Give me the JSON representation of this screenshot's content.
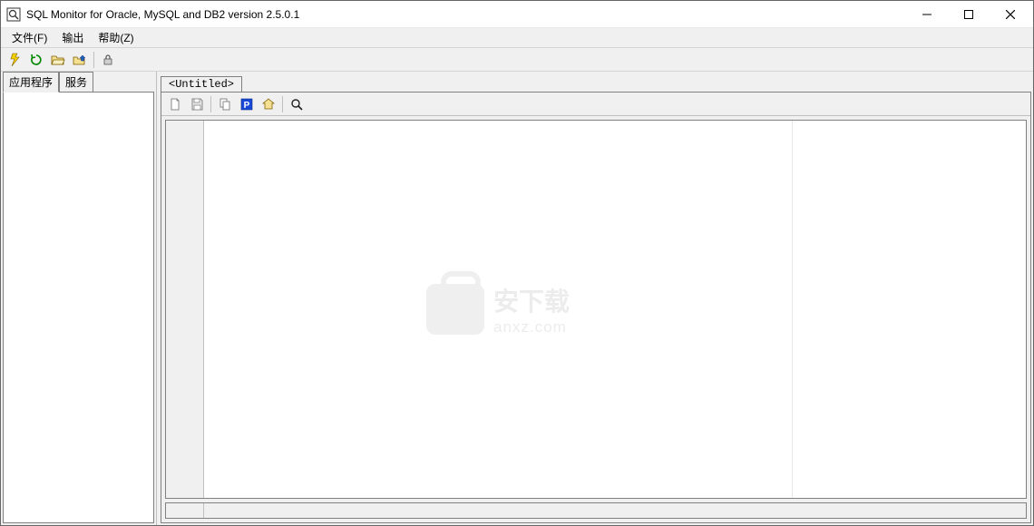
{
  "window": {
    "title": "SQL Monitor for Oracle, MySQL and DB2 version 2.5.0.1"
  },
  "menubar": {
    "items": [
      {
        "label": "文件(F)"
      },
      {
        "label": "输出"
      },
      {
        "label": "帮助(Z)"
      }
    ]
  },
  "toolbar": {
    "items": [
      {
        "name": "execute-icon",
        "color": "#e0c000"
      },
      {
        "name": "refresh-icon",
        "color": "#008800"
      },
      {
        "name": "open-icon",
        "color": "#b08000"
      },
      {
        "name": "folder-up-icon",
        "color": "#b08000"
      },
      {
        "name": "sep"
      },
      {
        "name": "lock-icon",
        "color": "#666666"
      }
    ]
  },
  "leftPanel": {
    "tabs": [
      {
        "label": "应用程序",
        "active": true
      },
      {
        "label": "服务",
        "active": false
      }
    ]
  },
  "rightPanel": {
    "tabs": [
      {
        "label": "<Untitled>",
        "active": true
      }
    ],
    "docToolbar": [
      {
        "name": "new-file-icon",
        "color": "#909090"
      },
      {
        "name": "save-icon",
        "color": "#909090"
      },
      {
        "name": "sep"
      },
      {
        "name": "copy-icon",
        "color": "#909090"
      },
      {
        "name": "park-icon",
        "color": "#1040d0"
      },
      {
        "name": "home-icon",
        "color": "#b08000"
      },
      {
        "name": "sep"
      },
      {
        "name": "zoom-icon",
        "color": "#303030"
      }
    ]
  },
  "watermark": {
    "line1": "安下载",
    "line2": "anxz.com"
  }
}
